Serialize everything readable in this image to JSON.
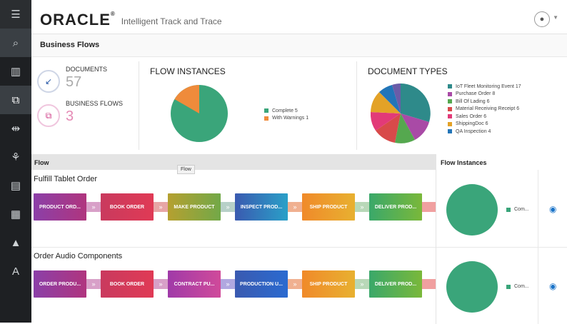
{
  "header": {
    "logo": "ORACLE",
    "app_title": "Intelligent Track and Trace"
  },
  "page_title": "Business Flows",
  "stats": {
    "documents_label": "DOCUMENTS",
    "documents_value": "57",
    "flows_label": "BUSINESS FLOWS",
    "flows_value": "3"
  },
  "flow_instances": {
    "title": "FLOW INSTANCES",
    "legend": [
      {
        "label": "Complete 5",
        "color": "#3aa57a"
      },
      {
        "label": "With Warnings 1",
        "color": "#ef8b3b"
      }
    ]
  },
  "document_types": {
    "title": "DOCUMENT TYPES",
    "legend": [
      {
        "label": "IoT Fleet Monitoring Event 17",
        "color": "#2e8a8a"
      },
      {
        "label": "Purchase Order 8",
        "color": "#a94aa6"
      },
      {
        "label": "Bill Of Lading 6",
        "color": "#55a84f"
      },
      {
        "label": "Material Receiving Receipt 6",
        "color": "#d84a4a"
      },
      {
        "label": "Sales Order 6",
        "color": "#e23a78"
      },
      {
        "label": "ShippingDoc 6",
        "color": "#e3a227"
      },
      {
        "label": "QA Inspection 4",
        "color": "#2275b8"
      }
    ]
  },
  "table": {
    "flow_header": "Flow",
    "instances_header": "Flow Instances",
    "tooltip": "Flow"
  },
  "flows": [
    {
      "name": "Fulfill Tablet Order",
      "steps": [
        "PRODUCT ORD...",
        "BOOK ORDER",
        "MAKE PRODUCT",
        "INSPECT PROD...",
        "SHIP PRODUCT",
        "DELIVER PROD..."
      ],
      "instance_legend": "Com..."
    },
    {
      "name": "Order Audio Components",
      "steps": [
        "ORDER PRODU...",
        "BOOK ORDER",
        "CONTRACT PU...",
        "PRODUCTION U...",
        "SHIP PRODUCT",
        "DELIVER PROD..."
      ],
      "instance_legend": "Com..."
    }
  ],
  "icons": [
    "menu-icon",
    "search-icon",
    "dashboard-icon",
    "business-flows-icon",
    "flow-designer-icon",
    "network-icon",
    "documents-icon",
    "document-types-icon",
    "warning-icon",
    "translate-icon",
    "user-icon",
    "eye-icon"
  ]
}
